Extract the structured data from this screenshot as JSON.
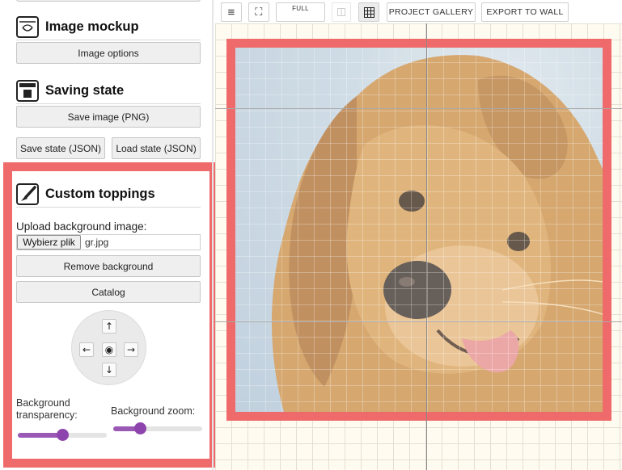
{
  "sections": {
    "image_mockup": {
      "title": "Image mockup",
      "icon": "mockup-icon"
    },
    "saving_state": {
      "title": "Saving state",
      "icon": "save-icon"
    },
    "custom_toppings": {
      "title": "Custom toppings",
      "icon": "brush-icon"
    }
  },
  "buttons": {
    "image_options": "Image options",
    "save_image": "Save image (PNG)",
    "save_state": "Save state (JSON)",
    "load_state": "Load state (JSON)",
    "remove_background": "Remove background",
    "catalog": "Catalog"
  },
  "upload": {
    "label": "Upload background image:",
    "button": "Wybierz plik",
    "filename": "gr.jpg"
  },
  "dpad": {
    "up": "↑",
    "down": "↓",
    "left": "←",
    "right": "→",
    "center": "◉"
  },
  "sliders": {
    "transparency": {
      "label": "Background transparency:",
      "value_fraction": 0.5
    },
    "zoom": {
      "label": "Background zoom:",
      "value_fraction": 0.3
    }
  },
  "toolbar": {
    "menu_icon": "≡",
    "fullscreen_icon": "⛶",
    "full_label": "FULL",
    "project_gallery": "PROJECT GALLERY",
    "export_to_wall": "EXPORT TO WALL"
  },
  "colors": {
    "highlight": "#ef6b6b",
    "slider_accent": "#9b59b6",
    "canvas_bg": "#fffbf0"
  }
}
